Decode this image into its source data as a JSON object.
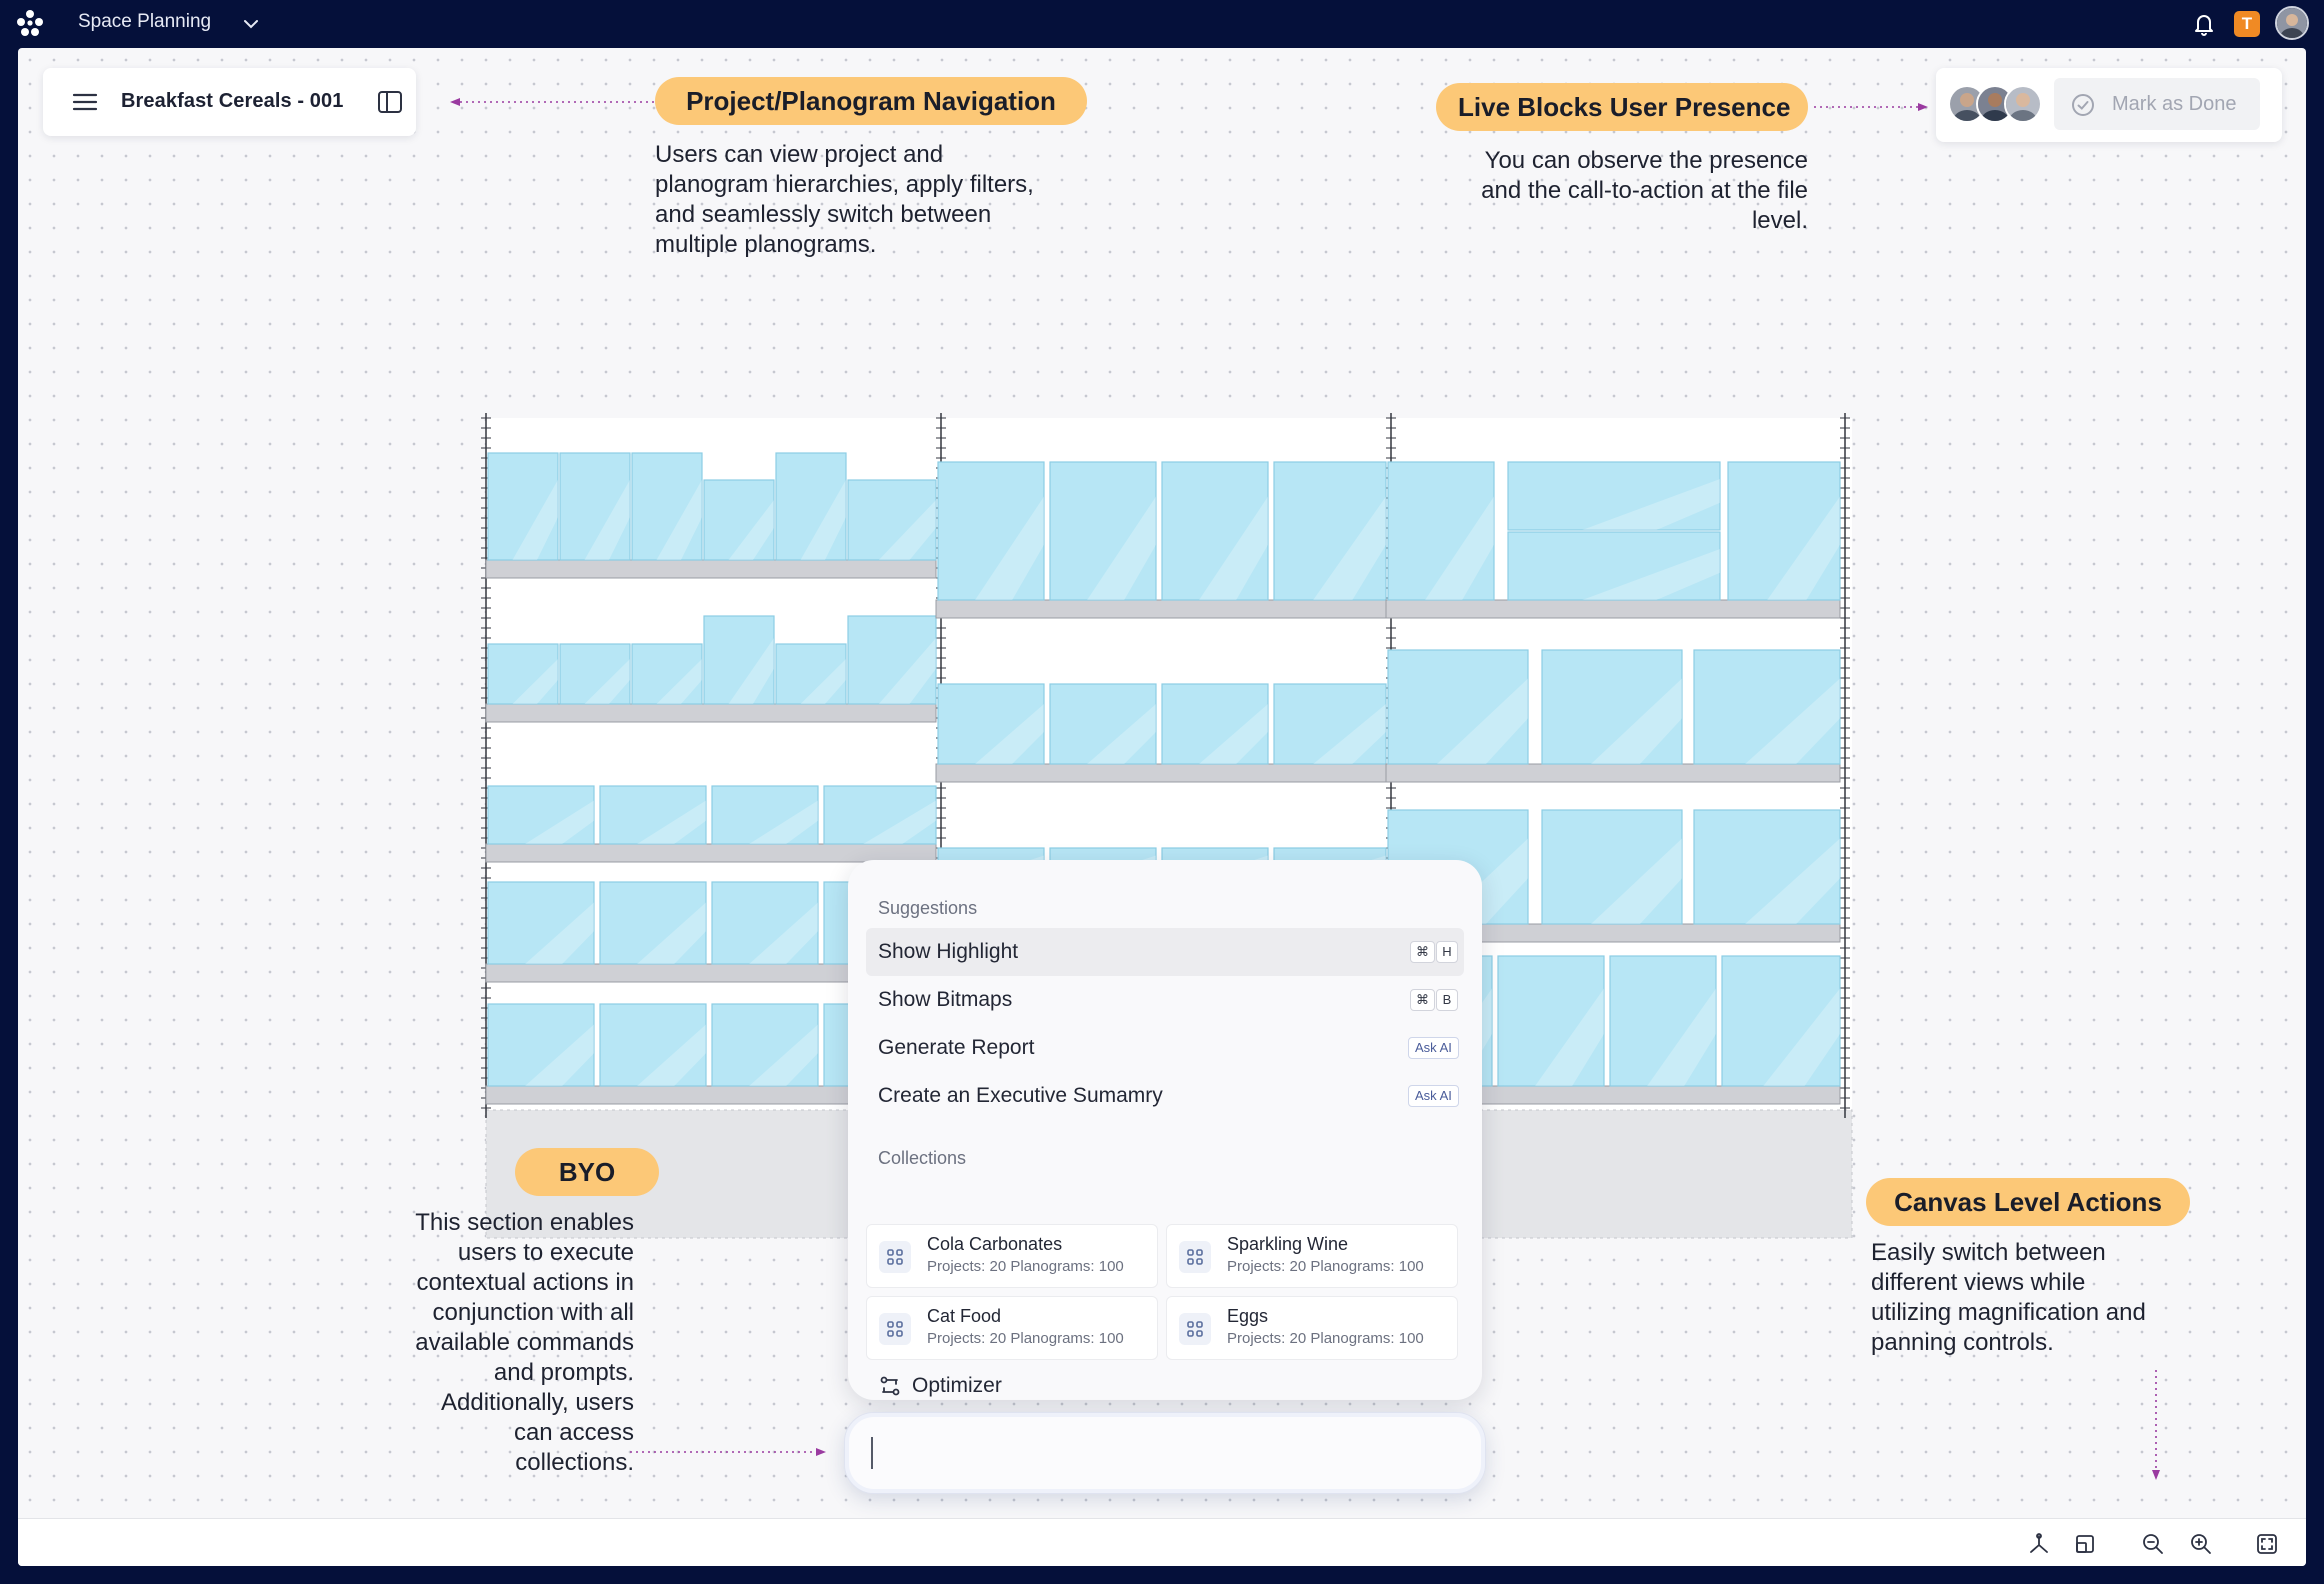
{
  "topbar": {
    "app_title": "Space Planning",
    "badge_letter": "T"
  },
  "nav": {
    "file_title": "Breakfast Cereals - 001"
  },
  "presence": {
    "mark_done_label": "Mark as Done"
  },
  "annotations": {
    "nav_pill": "Project/Planogram Navigation",
    "nav_note": [
      "Users can view project and",
      "planogram hierarchies, apply filters,",
      "and seamlessly switch between",
      "multiple planograms."
    ],
    "presence_pill": "Live Blocks User Presence",
    "presence_note": [
      "You can observe the presence",
      "and the call-to-action at the file",
      "level."
    ],
    "byo_pill": "BYO",
    "byo_note": [
      "This section enables",
      "users to execute",
      "contextual actions in",
      "conjunction with all",
      "available commands",
      "and prompts.",
      "Additionally, users",
      "can access",
      "collections."
    ],
    "canvas_pill": "Canvas Level Actions",
    "canvas_note": [
      "Easily switch between",
      "different views while",
      "utilizing magnification and",
      "panning controls."
    ]
  },
  "palette": {
    "suggestions_heading": "Suggestions",
    "suggestions": [
      {
        "label": "Show Highlight",
        "keys": [
          "⌘",
          "H"
        ],
        "highlighted": true
      },
      {
        "label": "Show Bitmaps",
        "keys": [
          "⌘",
          "B"
        ],
        "highlighted": false
      },
      {
        "label": "Generate Report",
        "ask": "Ask AI"
      },
      {
        "label": "Create an Executive Sumamry",
        "ask": "Ask AI"
      }
    ],
    "collections_heading": "Collections",
    "collections": [
      {
        "name": "Cola Carbonates",
        "stats": "Projects: 20 Planograms: 100"
      },
      {
        "name": "Sparkling Wine",
        "stats": "Projects: 20 Planograms: 100"
      },
      {
        "name": "Cat Food",
        "stats": "Projects: 20 Planograms: 100"
      },
      {
        "name": "Eggs",
        "stats": "Projects: 20 Planograms: 100"
      }
    ],
    "optimizer_label": "Optimizer"
  },
  "prompt": {
    "value": ""
  },
  "colors": {
    "frame": "#05103a",
    "pill": "#fcc877",
    "product": "#b7e6f5",
    "shelf": "#cfd0d5",
    "arrow": "#9a3aa0"
  }
}
